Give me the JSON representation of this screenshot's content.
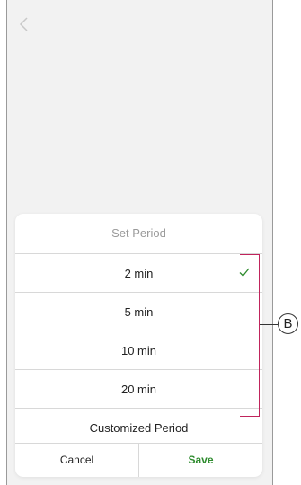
{
  "sheet": {
    "title": "Set Period",
    "options": [
      {
        "label": "2 min",
        "selected": true
      },
      {
        "label": "5 min",
        "selected": false
      },
      {
        "label": "10 min",
        "selected": false
      },
      {
        "label": "20 min",
        "selected": false
      },
      {
        "label": "Customized Period",
        "selected": false
      }
    ],
    "cancel_label": "Cancel",
    "save_label": "Save"
  },
  "annotation": {
    "label": "B"
  },
  "colors": {
    "accent_green": "#2e8b2e",
    "bracket_magenta": "#c0245c",
    "background": "#f2f2f2"
  },
  "icons": {
    "back": "chevron-left-icon",
    "selected": "checkmark-icon"
  }
}
